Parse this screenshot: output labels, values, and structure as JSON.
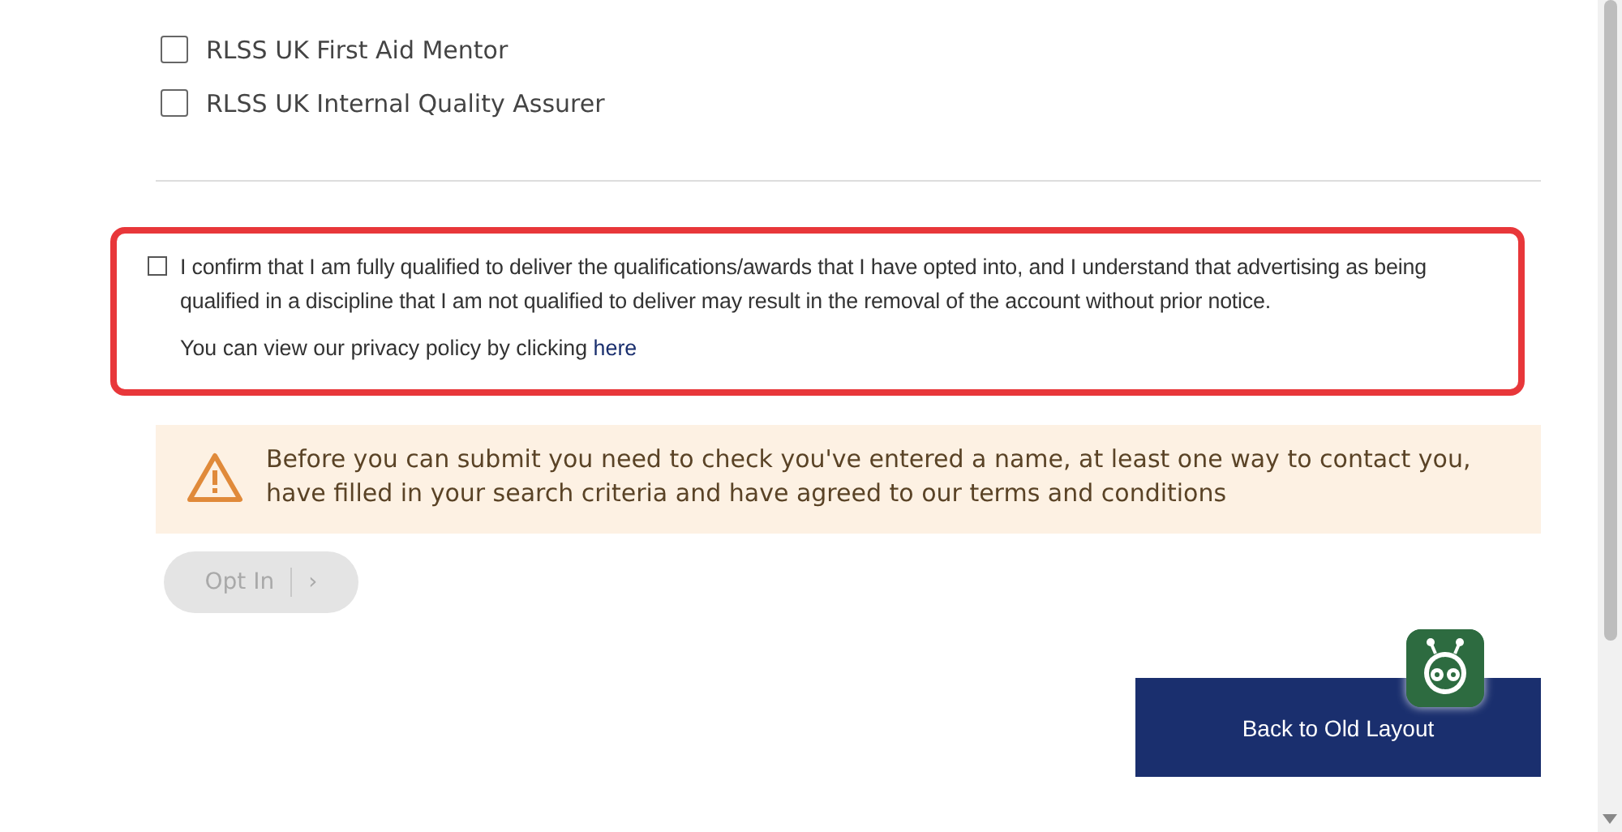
{
  "qualifications": [
    {
      "label": "RLSS UK First Aid Mentor",
      "checked": false
    },
    {
      "label": "RLSS UK Internal Quality Assurer",
      "checked": false
    }
  ],
  "confirmation": {
    "checked": false,
    "text": "I confirm that I am fully qualified to deliver the qualifications/awards that I have opted into, and I understand that advertising as being qualified in a discipline that I am not qualified to deliver may result in the removal of the account without prior notice.",
    "privacy_text": "You can view our privacy policy by clicking ",
    "privacy_link": "here"
  },
  "warning": {
    "text": "Before you can submit you need to check you've entered a name, at least one way to contact you, have filled in your search criteria and have agreed to our terms and conditions"
  },
  "submit_button": {
    "label": "Opt In",
    "caret": "›",
    "disabled": true
  },
  "old_layout_button": {
    "label": "Back to Old Layout"
  }
}
